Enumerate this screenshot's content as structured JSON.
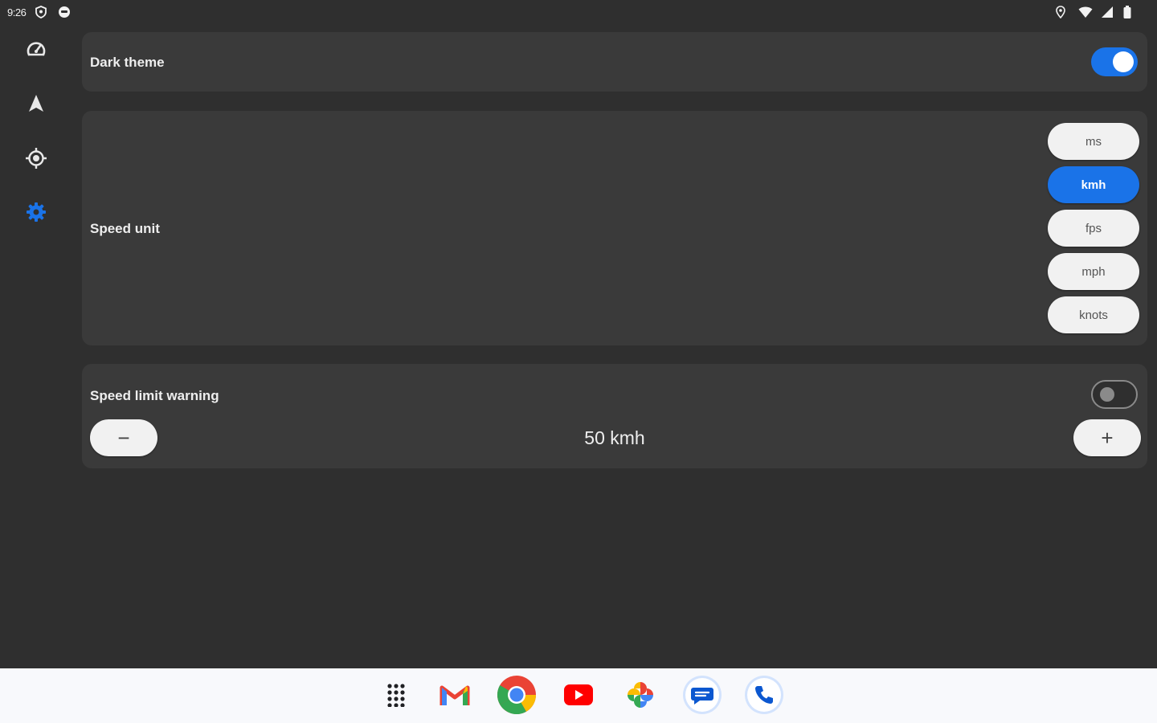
{
  "status_bar": {
    "time": "9:26",
    "left_icons": [
      "shield-icon",
      "notification-icon"
    ],
    "right_icons": [
      "location-icon",
      "wifi-icon",
      "signal-icon",
      "battery-icon"
    ]
  },
  "nav_rail": {
    "items": [
      {
        "name": "speedometer",
        "icon": "speedometer-icon",
        "active": false
      },
      {
        "name": "navigation",
        "icon": "navigation-arrow-icon",
        "active": false
      },
      {
        "name": "location",
        "icon": "gps-location-icon",
        "active": false
      },
      {
        "name": "settings",
        "icon": "gear-icon",
        "active": true
      }
    ]
  },
  "settings": {
    "dark_theme": {
      "label": "Dark theme",
      "enabled": true
    },
    "speed_unit": {
      "label": "Speed unit",
      "options": [
        "ms",
        "kmh",
        "fps",
        "mph",
        "knots"
      ],
      "selected": "kmh"
    },
    "speed_limit": {
      "label": "Speed limit warning",
      "enabled": false,
      "value_text": "50 kmh",
      "decrement_label": "−",
      "increment_label": "+"
    }
  },
  "dock": {
    "apps": [
      "app-drawer-icon",
      "gmail-icon",
      "chrome-icon",
      "youtube-icon",
      "photos-icon",
      "messages-icon",
      "phone-icon"
    ]
  },
  "colors": {
    "background": "#2f2f2f",
    "card": "#3a3a3a",
    "accent": "#1a73e8",
    "button": "#f1f1f1"
  }
}
